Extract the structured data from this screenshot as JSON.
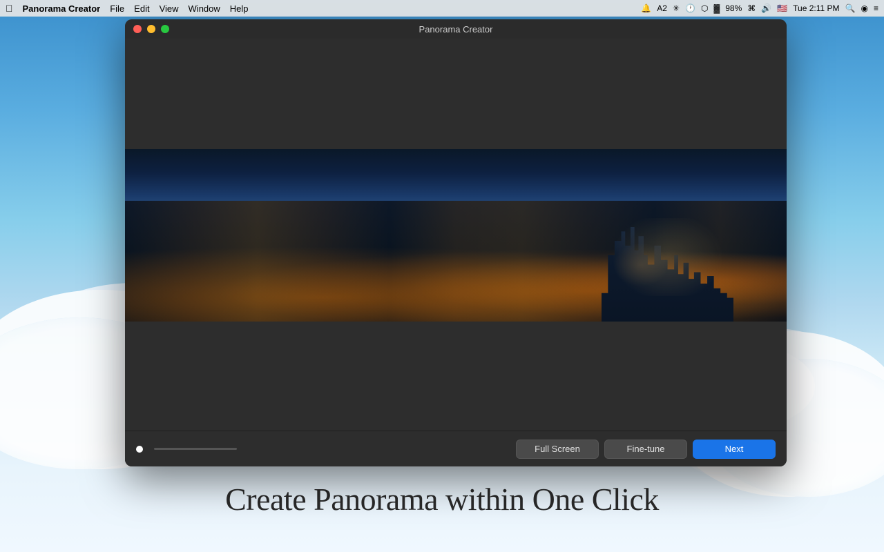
{
  "desktop": {
    "tagline": "Create Panorama within One Click"
  },
  "menubar": {
    "apple_label": "",
    "app_name": "Panorama Creator",
    "menu_items": [
      "File",
      "Edit",
      "View",
      "Window",
      "Help"
    ],
    "time": "Tue 2:11 PM",
    "battery": "98%"
  },
  "window": {
    "title": "Panorama Creator",
    "traffic_lights": {
      "close_title": "Close",
      "minimize_title": "Minimize",
      "maximize_title": "Maximize"
    }
  },
  "toolbar": {
    "fullscreen_label": "Full Screen",
    "finetune_label": "Fine-tune",
    "next_label": "Next"
  }
}
